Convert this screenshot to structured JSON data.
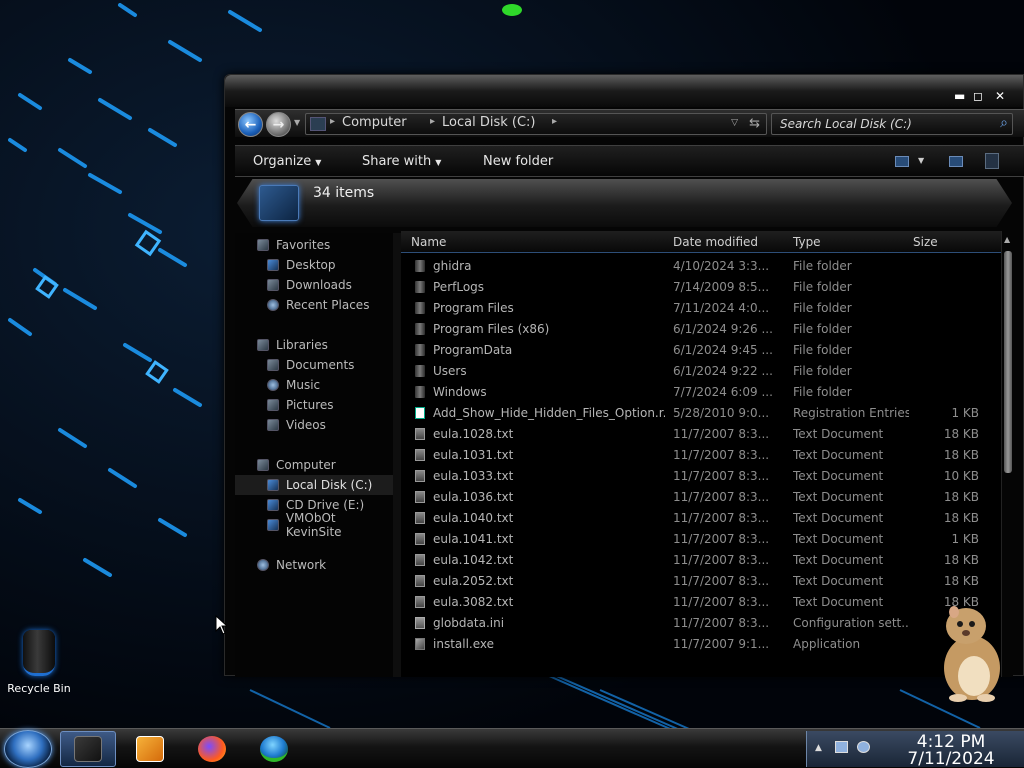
{
  "desktop": {
    "recycle_bin_label": "Recycle Bin"
  },
  "window": {
    "controls": {
      "minimize": "▬",
      "maximize": "◻",
      "close": "✕"
    },
    "address": {
      "crumbs": [
        "Computer",
        "Local Disk (C:)"
      ]
    },
    "search": {
      "placeholder": "Search Local Disk (C:)"
    },
    "toolbar": {
      "organize": "Organize",
      "share": "Share with",
      "new_folder": "New folder"
    },
    "details": {
      "item_count": "34 items"
    }
  },
  "nav_pane": {
    "favorites": {
      "label": "Favorites",
      "items": [
        "Desktop",
        "Downloads",
        "Recent Places"
      ]
    },
    "libraries": {
      "label": "Libraries",
      "items": [
        "Documents",
        "Music",
        "Pictures",
        "Videos"
      ]
    },
    "computer": {
      "label": "Computer",
      "items": [
        "Local Disk (C:)",
        "CD Drive (E:)",
        "VMObOt KevinSite"
      ]
    },
    "network": {
      "label": "Network"
    }
  },
  "file_list": {
    "columns": {
      "name": "Name",
      "date": "Date modified",
      "type": "Type",
      "size": "Size"
    },
    "rows": [
      {
        "name": "ghidra",
        "date": "4/10/2024 3:3...",
        "type": "File folder",
        "size": "",
        "icon": "folder"
      },
      {
        "name": "PerfLogs",
        "date": "7/14/2009 8:5...",
        "type": "File folder",
        "size": "",
        "icon": "folder"
      },
      {
        "name": "Program Files",
        "date": "7/11/2024 4:0...",
        "type": "File folder",
        "size": "",
        "icon": "folder"
      },
      {
        "name": "Program Files (x86)",
        "date": "6/1/2024 9:26 ...",
        "type": "File folder",
        "size": "",
        "icon": "folder"
      },
      {
        "name": "ProgramData",
        "date": "6/1/2024 9:45 ...",
        "type": "File folder",
        "size": "",
        "icon": "folder"
      },
      {
        "name": "Users",
        "date": "6/1/2024 9:22 ...",
        "type": "File folder",
        "size": "",
        "icon": "folder"
      },
      {
        "name": "Windows",
        "date": "7/7/2024 6:09 ...",
        "type": "File folder",
        "size": "",
        "icon": "folder"
      },
      {
        "name": "Add_Show_Hide_Hidden_Files_Option.r...",
        "date": "5/28/2010 9:0...",
        "type": "Registration Entries",
        "size": "1 KB",
        "icon": "reg"
      },
      {
        "name": "eula.1028.txt",
        "date": "11/7/2007 8:3...",
        "type": "Text Document",
        "size": "18 KB",
        "icon": "doc"
      },
      {
        "name": "eula.1031.txt",
        "date": "11/7/2007 8:3...",
        "type": "Text Document",
        "size": "18 KB",
        "icon": "doc"
      },
      {
        "name": "eula.1033.txt",
        "date": "11/7/2007 8:3...",
        "type": "Text Document",
        "size": "10 KB",
        "icon": "doc"
      },
      {
        "name": "eula.1036.txt",
        "date": "11/7/2007 8:3...",
        "type": "Text Document",
        "size": "18 KB",
        "icon": "doc"
      },
      {
        "name": "eula.1040.txt",
        "date": "11/7/2007 8:3...",
        "type": "Text Document",
        "size": "18 KB",
        "icon": "doc"
      },
      {
        "name": "eula.1041.txt",
        "date": "11/7/2007 8:3...",
        "type": "Text Document",
        "size": "1 KB",
        "icon": "doc"
      },
      {
        "name": "eula.1042.txt",
        "date": "11/7/2007 8:3...",
        "type": "Text Document",
        "size": "18 KB",
        "icon": "doc"
      },
      {
        "name": "eula.2052.txt",
        "date": "11/7/2007 8:3...",
        "type": "Text Document",
        "size": "18 KB",
        "icon": "doc"
      },
      {
        "name": "eula.3082.txt",
        "date": "11/7/2007 8:3...",
        "type": "Text Document",
        "size": "18 KB",
        "icon": "doc"
      },
      {
        "name": "globdata.ini",
        "date": "11/7/2007 8:3...",
        "type": "Configuration sett...",
        "size": "",
        "icon": "ini"
      },
      {
        "name": "install.exe",
        "date": "11/7/2007 9:1...",
        "type": "Application",
        "size": "",
        "icon": "exe"
      }
    ]
  },
  "taskbar": {
    "clock": {
      "time": "4:12 PM",
      "date": "7/11/2024"
    },
    "apps": [
      "explorer",
      "media-player",
      "firefox",
      "internet-download-manager"
    ]
  },
  "colors": {
    "accent": "#2f86e0",
    "wallpaper_glow": "#1ea0ff",
    "window_bg": "#050505"
  }
}
